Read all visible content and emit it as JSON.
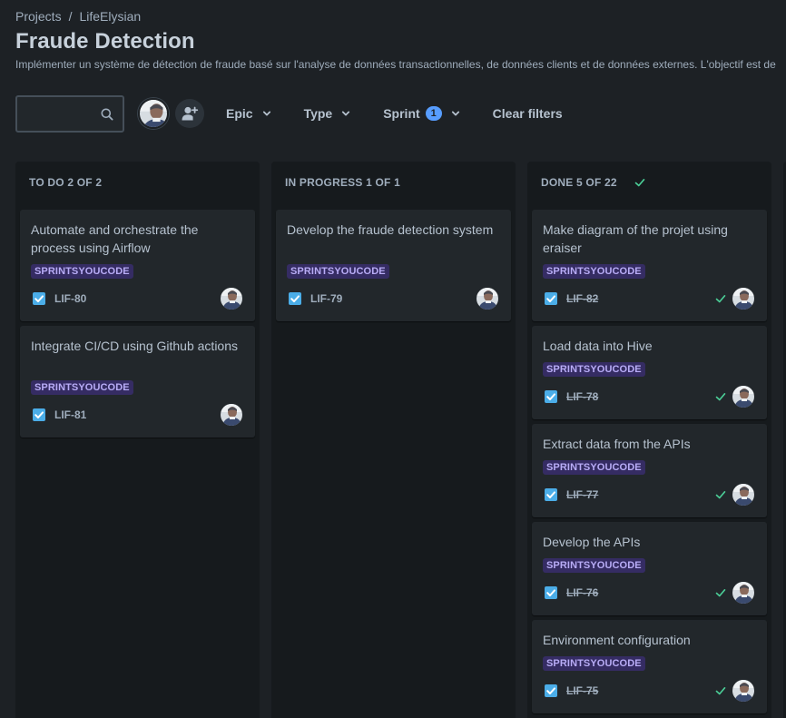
{
  "breadcrumb": {
    "root": "Projects",
    "separator": "/",
    "project": "LifeElysian"
  },
  "page": {
    "title": "Fraude Detection",
    "description": "Implémenter un système de détection de fraude basé sur l'analyse de données transactionnelles, de données clients et de données externes. L'objectif est de"
  },
  "filters": {
    "search_placeholder": "",
    "epic_label": "Epic",
    "type_label": "Type",
    "sprint_label": "Sprint",
    "sprint_count": "1",
    "clear_label": "Clear filters"
  },
  "colors": {
    "accent": "#579dff",
    "label_bg": "#352c63",
    "label_text": "#b8acf6",
    "task_icon": "#4bade8",
    "done_check": "#4bce97"
  },
  "columns": [
    {
      "header": "TO DO 2 OF 2",
      "cards": [
        {
          "title": "Automate and orchestrate the process using Airflow",
          "label": "SPRINTSYOUCODE",
          "key": "LIF-80"
        },
        {
          "title": "Integrate CI/CD using Github actions",
          "label": "SPRINTSYOUCODE",
          "key": "LIF-81"
        }
      ]
    },
    {
      "header": "IN PROGRESS 1 OF 1",
      "cards": [
        {
          "title": "Develop the fraude detection system",
          "label": "SPRINTSYOUCODE",
          "key": "LIF-79"
        }
      ]
    },
    {
      "header": "DONE 5 OF 22",
      "cards": [
        {
          "title": "Make diagram of the projet using eraiser",
          "label": "SPRINTSYOUCODE",
          "key": "LIF-82"
        },
        {
          "title": "Load data into Hive",
          "label": "SPRINTSYOUCODE",
          "key": "LIF-78"
        },
        {
          "title": "Extract data from the APIs",
          "label": "SPRINTSYOUCODE",
          "key": "LIF-77"
        },
        {
          "title": "Develop the APIs",
          "label": "SPRINTSYOUCODE",
          "key": "LIF-76"
        },
        {
          "title": "Environment configuration",
          "label": "SPRINTSYOUCODE",
          "key": "LIF-75"
        }
      ]
    }
  ]
}
